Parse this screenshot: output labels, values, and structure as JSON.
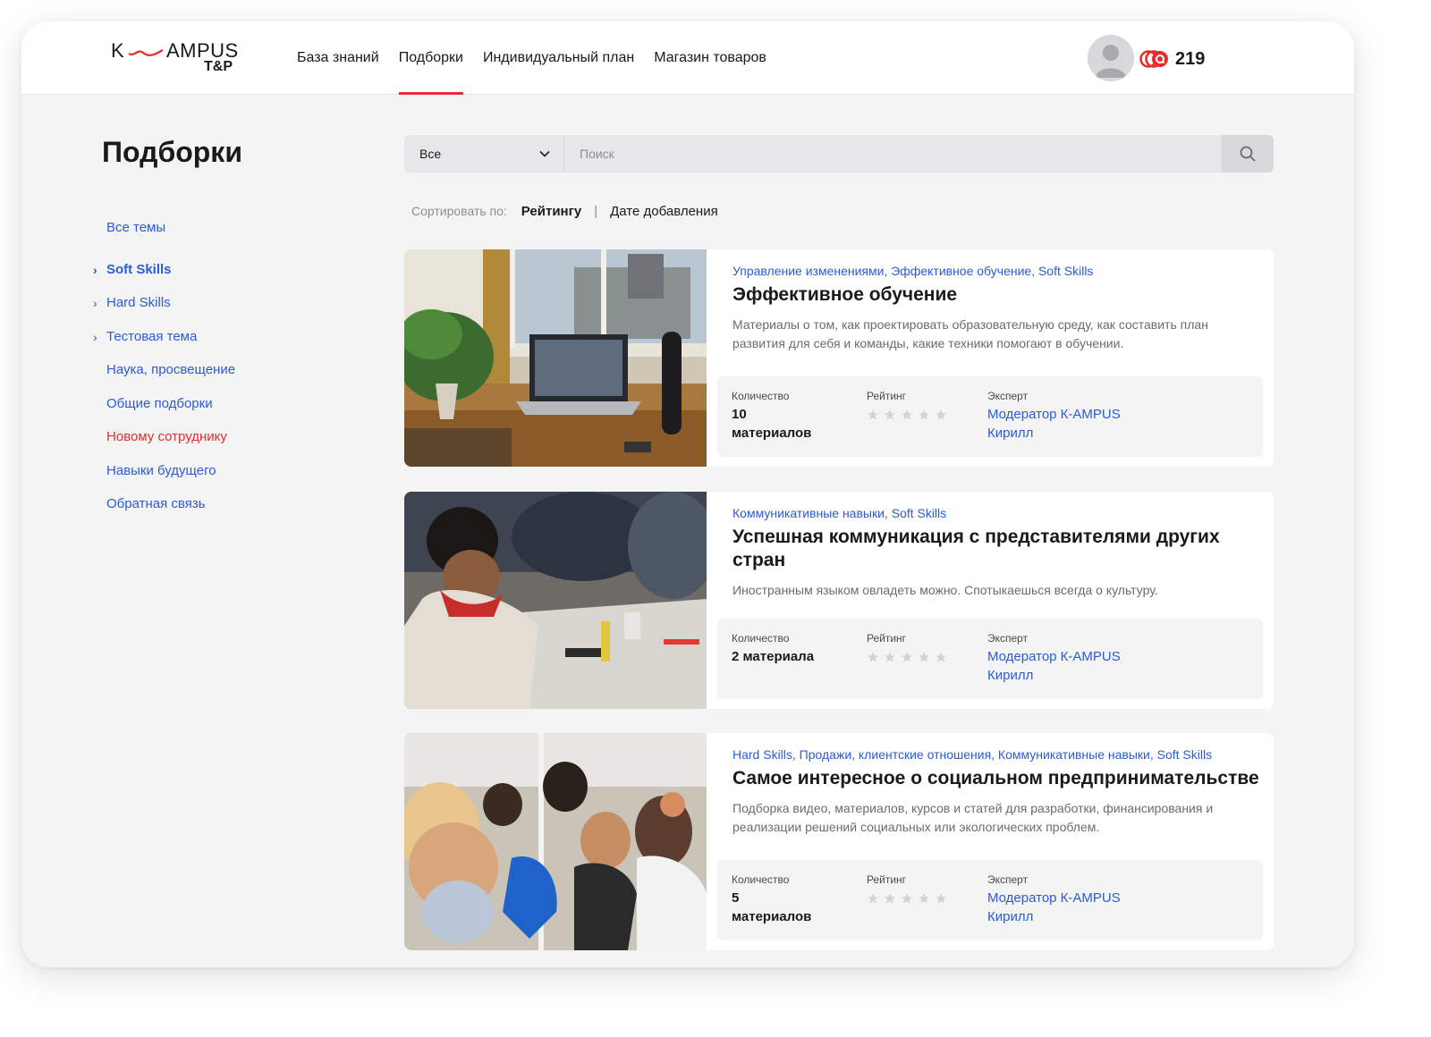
{
  "logo": {
    "part1": "K",
    "part2": "AMPUS",
    "part3": "T&P"
  },
  "nav": [
    "База знаний",
    "Подборки",
    "Индивидуальный план",
    "Магазин товаров"
  ],
  "user": {
    "coins": "219"
  },
  "page_title": "Подборки",
  "sidebar": [
    {
      "label": "Все темы",
      "chevron": ""
    },
    {
      "label": "Soft Skills",
      "chevron": "›"
    },
    {
      "label": "Hard Skills",
      "chevron": "›"
    },
    {
      "label": "Тестовая тема",
      "chevron": "›"
    },
    {
      "label": "Наука, просвещение",
      "chevron": ""
    },
    {
      "label": "Общие подборки",
      "chevron": ""
    },
    {
      "label": "Новому сотруднику",
      "chevron": ""
    },
    {
      "label": "Навыки будущего",
      "chevron": ""
    },
    {
      "label": "Обратная связь",
      "chevron": ""
    }
  ],
  "search": {
    "filter_value": "Все",
    "placeholder": "Поиск"
  },
  "sort": {
    "label": "Сортировать по:",
    "option1": "Рейтингу",
    "separator": "|",
    "option2": "Дате добавления"
  },
  "meta_labels": {
    "count": "Количество",
    "rating": "Рейтинг",
    "expert": "Эксперт"
  },
  "cards": [
    {
      "tags": "Управление изменениями, Эффективное обучение, Soft Skills",
      "title": "Эффективное обучение",
      "description": "Материалы о том, как проектировать образовательную среду, как составить план развития для себя и команды, какие техники помогают в обучении.",
      "count": "10 материалов",
      "rating": 0,
      "expert_line1": "Модератор К-AMPUS",
      "expert_line2": "Кирилл"
    },
    {
      "tags": "Коммуникативные навыки, Soft Skills",
      "title": "Успешная коммуникация с представителями других стран",
      "description": "Иностранным языком овладеть можно. Спотыкаешься всегда о культуру.",
      "count": "2 материала",
      "rating": 0,
      "expert_line1": "Модератор К-AMPUS",
      "expert_line2": "Кирилл"
    },
    {
      "tags": "Hard Skills, Продажи, клиентские отношения, Коммуникативные навыки, Soft Skills",
      "title": "Самое интересное о социальном предпринимательстве",
      "description": "Подборка видео, материалов, курсов и статей для разработки, финансирования и реализации решений социальных или экологических проблем.",
      "count": "5 материалов",
      "rating": 0,
      "expert_line1": "Модератор К-AMPUS",
      "expert_line2": "Кирилл"
    }
  ],
  "colors": {
    "accent": "#e62b2b",
    "link": "#2a5bd7",
    "background": "#f4f4f5"
  }
}
